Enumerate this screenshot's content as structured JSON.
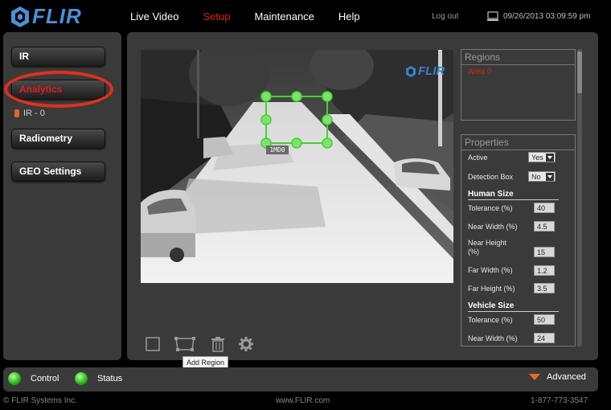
{
  "header": {
    "logo_text": "FLIR",
    "nav": [
      "Live Video",
      "Setup",
      "Maintenance",
      "Help"
    ],
    "active_nav": "Setup",
    "logout": "Log out",
    "datetime": "09/26/2013 03:09:59 pm"
  },
  "sidebar": {
    "items": [
      {
        "label": "IR"
      },
      {
        "label": "Analytics"
      },
      {
        "label": "Radiometry"
      },
      {
        "label": "GEO Settings"
      }
    ],
    "sub_item": "IR - 0"
  },
  "video": {
    "overlay_logo": "FLIR",
    "region_tag": "1MD0"
  },
  "tools": {
    "tooltip": "Add Region",
    "icons": [
      "rectangle-icon",
      "polygon-icon",
      "trash-icon",
      "gear-icon"
    ]
  },
  "regions": {
    "title": "Regions",
    "items": [
      "Area 0"
    ]
  },
  "properties": {
    "title": "Properties",
    "active_label": "Active",
    "active_value": "Yes",
    "detection_label": "Detection Box",
    "detection_value": "No",
    "human_size": {
      "heading": "Human Size",
      "tolerance_label": "Tolerance (%)",
      "tolerance": "40",
      "near_width_label": "Near Width (%)",
      "near_width": "4.5",
      "near_height_label": "Near Height (%)",
      "near_height": "15",
      "far_width_label": "Far Width (%)",
      "far_width": "1.2",
      "far_height_label": "Far Height (%)",
      "far_height": "3.5"
    },
    "vehicle_size": {
      "heading": "Vehicle Size",
      "tolerance_label": "Tolerance (%)",
      "tolerance": "50",
      "near_width_label": "Near Width (%)",
      "near_width": "24"
    }
  },
  "bottom": {
    "control": "Control",
    "status": "Status",
    "advanced": "Advanced"
  },
  "footer": {
    "copyright": "© FLIR Systems Inc.",
    "website": "www.FLIR.com",
    "phone": "1-877-773-3547"
  },
  "colors": {
    "accent_red": "#e0201a",
    "brand_blue": "#4d8fd6",
    "led_green": "#22b31a",
    "panel": "#3a3a3a"
  }
}
